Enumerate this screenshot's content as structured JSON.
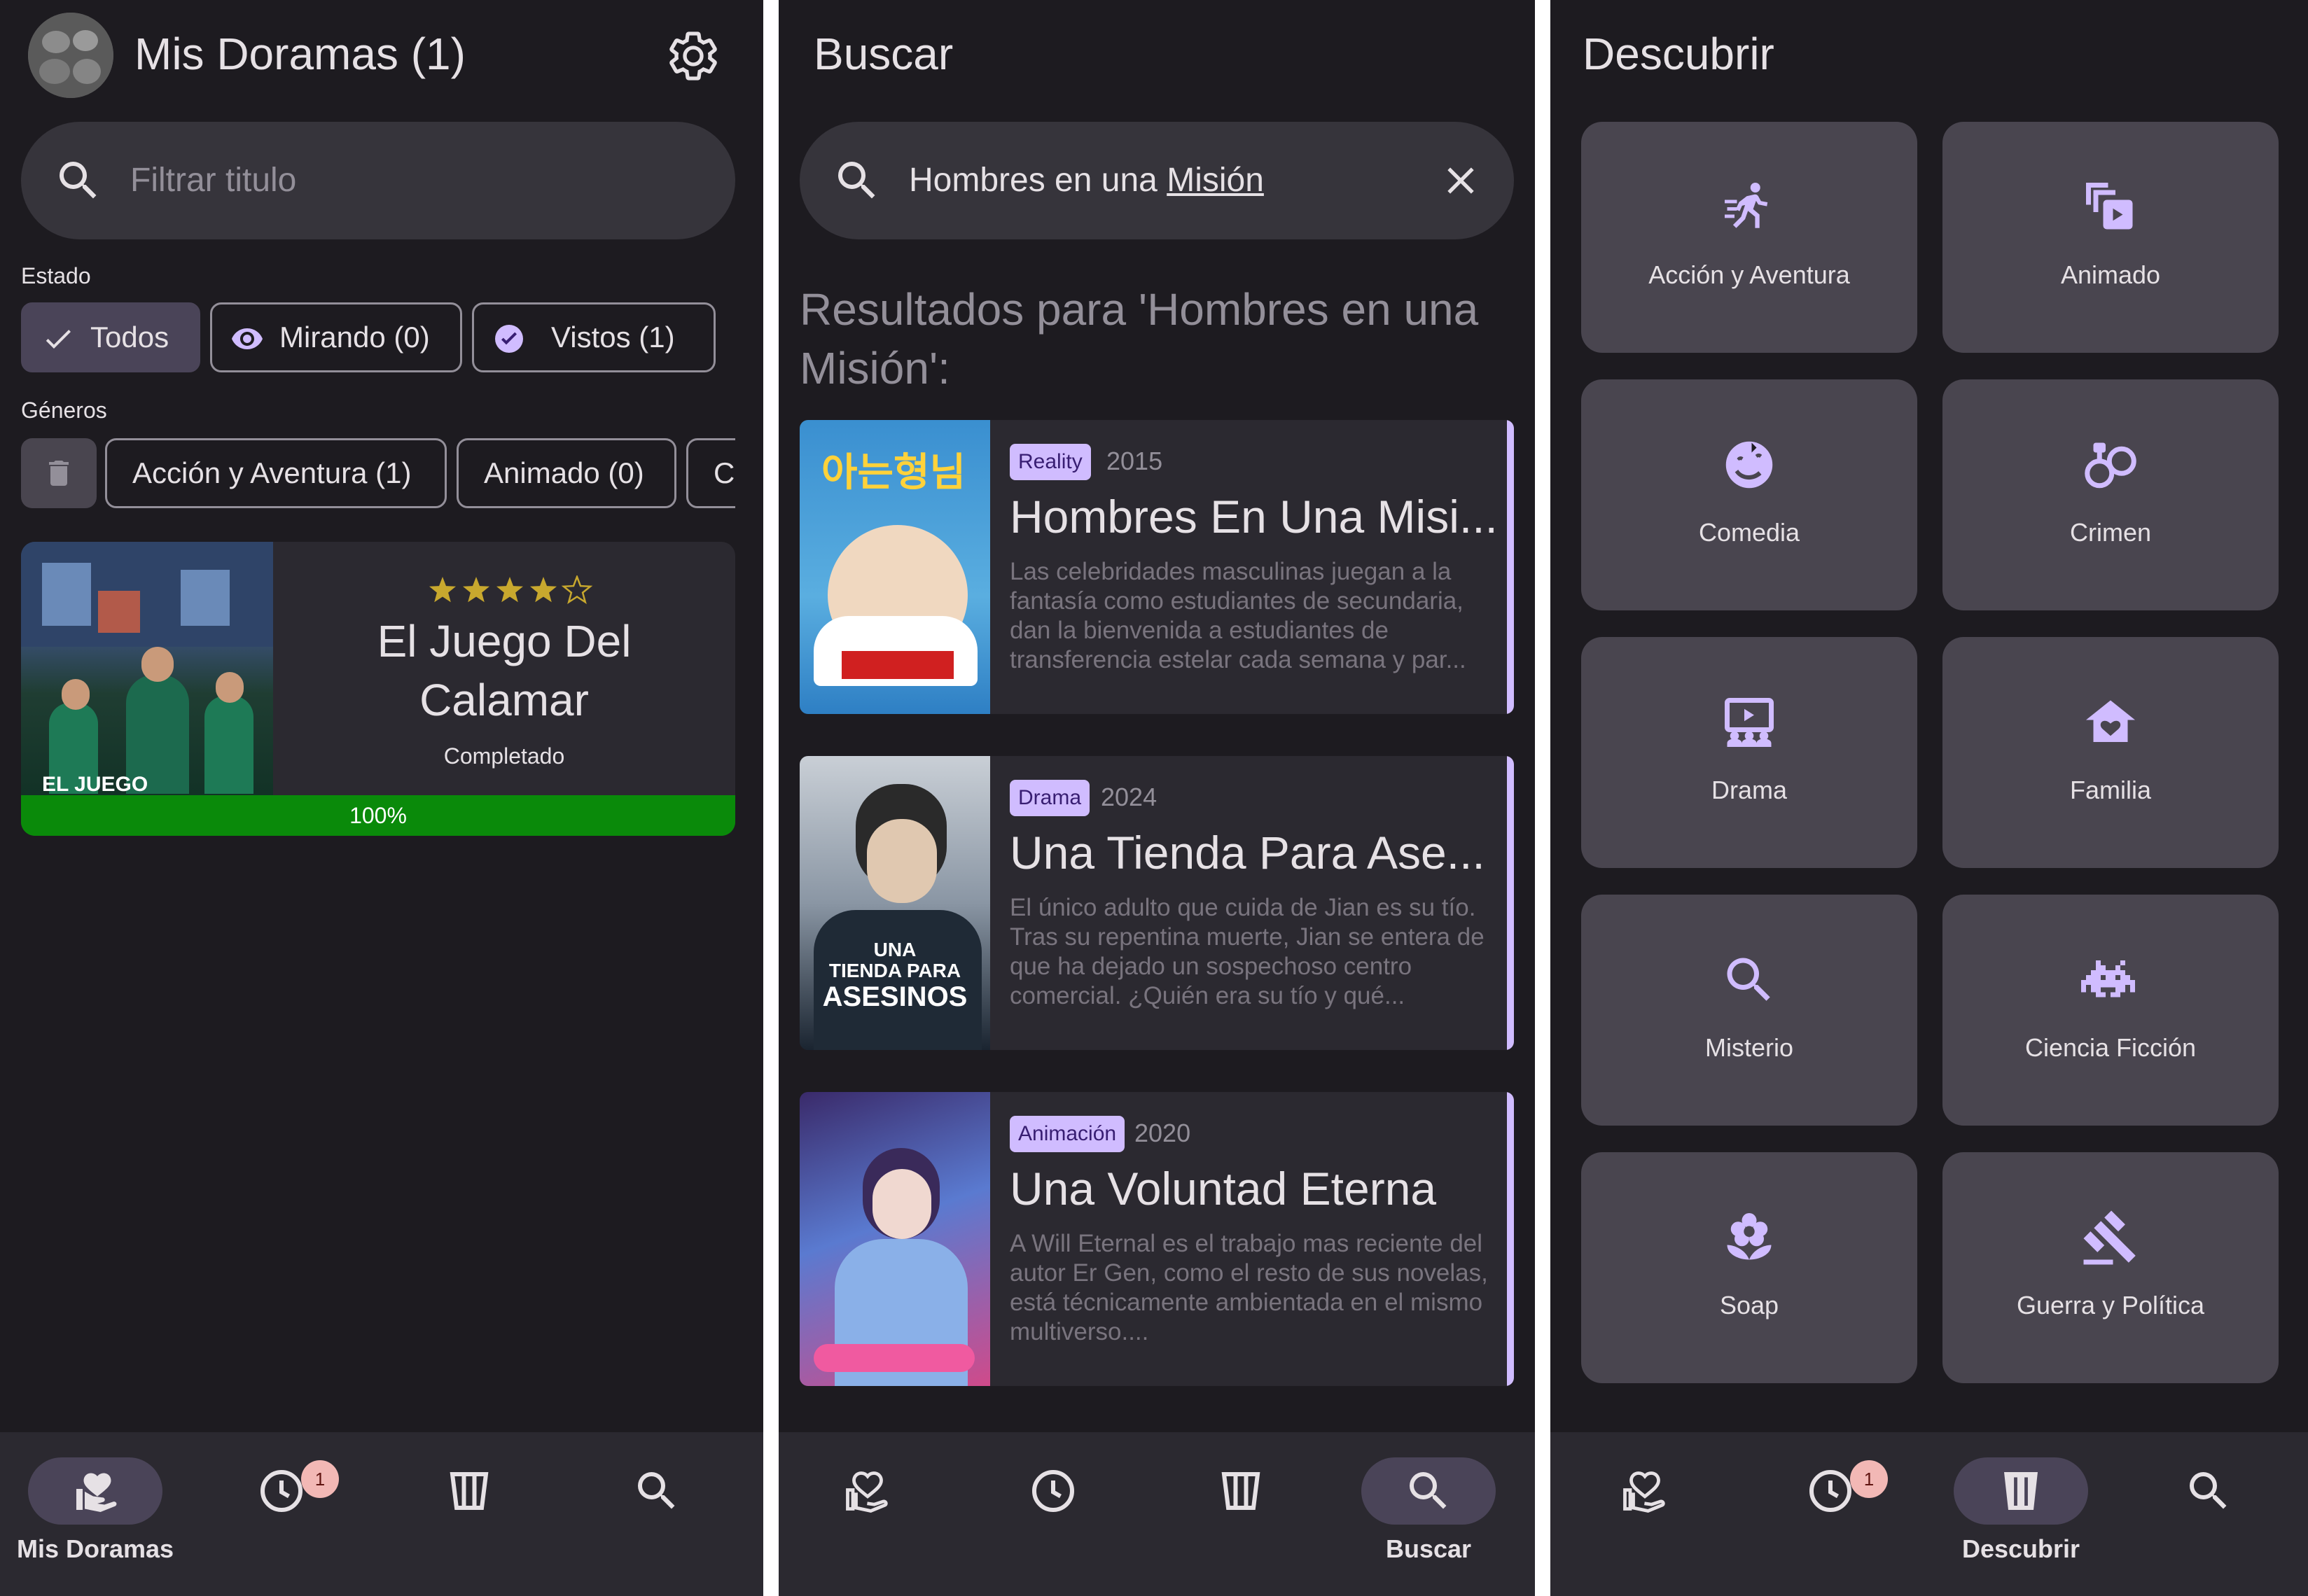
{
  "colors": {
    "background": "#1d1b20",
    "surface": "#2b2930",
    "primary": "#d0bcff",
    "progress": "#0a8a0a",
    "star": "#c8a82e",
    "badge": "#f2b8b5"
  },
  "screen1": {
    "title": "Mis Doramas (1)",
    "avatar_icon": "avatar-icon",
    "settings_icon": "gear-icon",
    "filter": {
      "placeholder": "Filtrar titulo"
    },
    "estado_label": "Estado",
    "estado_chips": [
      {
        "label": "Todos",
        "icon": "check-icon",
        "selected": true
      },
      {
        "label": "Mirando (0)",
        "icon": "eye-icon",
        "selected": false
      },
      {
        "label": "Vistos (1)",
        "icon": "check-circle-icon",
        "selected": false
      }
    ],
    "generos_label": "Géneros",
    "genre_chips": [
      {
        "label": "Acción y Aventura (1)"
      },
      {
        "label": "Animado (0)"
      },
      {
        "label": "Co"
      }
    ],
    "card": {
      "title_line1": "El Juego Del",
      "title_line2": "Calamar",
      "status": "Completado",
      "rating": 4,
      "rating_max": 5,
      "progress": 1.0,
      "progress_label": "100%",
      "poster_text": "EL JUEGO"
    }
  },
  "screen2": {
    "title": "Buscar",
    "search": {
      "query_prefix": "Hombres en una ",
      "query_underlined": "Misión"
    },
    "results_heading_line1": "Resultados para 'Hombres en una",
    "results_heading_line2": "Misión':",
    "results": [
      {
        "badge": "Reality",
        "year": "2015",
        "title": "Hombres En Una Misi...",
        "description": "Las celebridades masculinas juegan a la fantasía como estudiantes de secundaria, dan la bienvenida a estudiantes de transferencia estelar cada semana y par...",
        "poster_text": "아는형님"
      },
      {
        "badge": "Drama",
        "year": "2024",
        "title": "Una Tienda Para Ase...",
        "description": "El único adulto que cuida de Jian es su tío. Tras su repentina muerte, Jian se entera de que ha dejado un sospechoso centro comercial. ¿Quién era su tío y qué...",
        "poster_text_line1": "UNA",
        "poster_text_line2": "TIENDA PARA",
        "poster_text_line3": "ASESINOS"
      },
      {
        "badge": "Animación",
        "year": "2020",
        "title": "Una Voluntad Eterna",
        "description": "A Will Eternal es el trabajo mas reciente del autor Er Gen, como el resto de sus novelas, está técnicamente ambientada en el mismo multiverso...."
      }
    ]
  },
  "screen3": {
    "title": "Descubrir",
    "genres": [
      {
        "label": "Acción y Aventura",
        "icon": "running-icon"
      },
      {
        "label": "Animado",
        "icon": "animation-icon"
      },
      {
        "label": "Comedia",
        "icon": "comedy-icon"
      },
      {
        "label": "Crimen",
        "icon": "handcuffs-icon"
      },
      {
        "label": "Drama",
        "icon": "theater-icon"
      },
      {
        "label": "Familia",
        "icon": "family-home-icon"
      },
      {
        "label": "Misterio",
        "icon": "magnifier-icon"
      },
      {
        "label": "Ciencia Ficción",
        "icon": "space-invader-icon"
      },
      {
        "label": "Soap",
        "icon": "flower-icon"
      },
      {
        "label": "Guerra y Política",
        "icon": "gavel-icon"
      }
    ]
  },
  "nav": {
    "items": [
      {
        "label": "Mis Doramas",
        "icon": "heart-hand-icon"
      },
      {
        "label": "",
        "icon": "history-icon",
        "badge": "1"
      },
      {
        "label": "Descubrir",
        "icon": "columns-icon"
      },
      {
        "label": "Buscar",
        "icon": "search-icon"
      }
    ]
  }
}
